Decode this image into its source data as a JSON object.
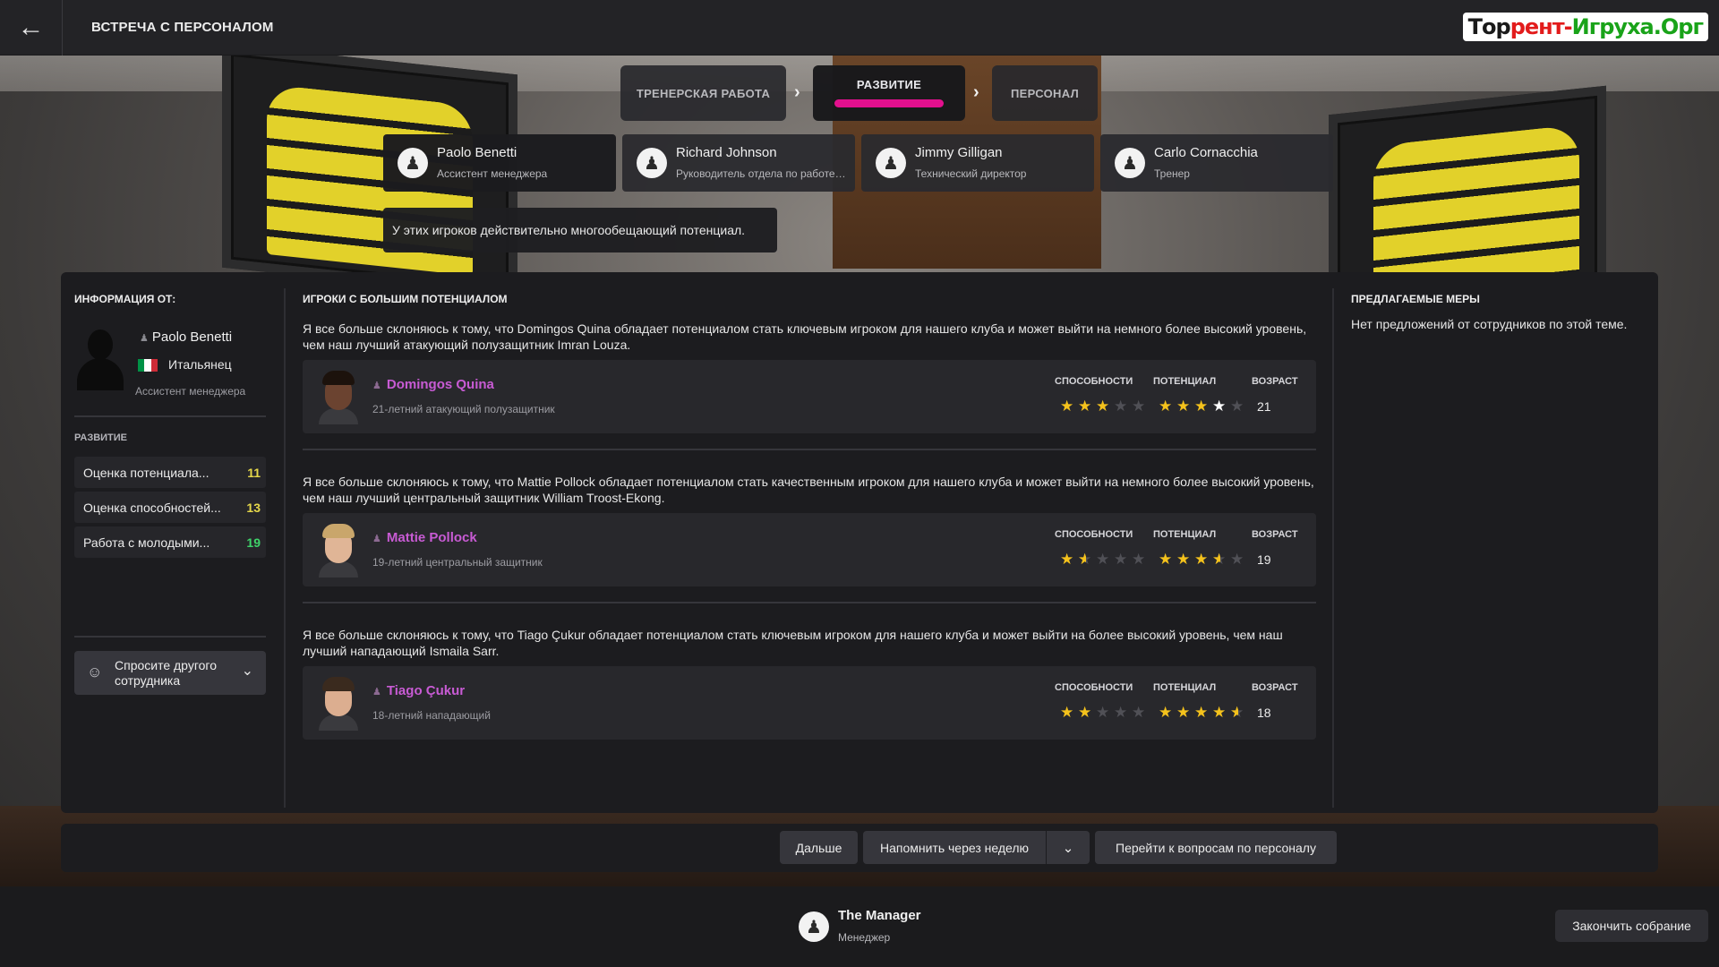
{
  "header": {
    "back_icon": "arrow-left-icon",
    "title": "ВСТРЕЧА С ПЕРСОНАЛОМ",
    "watermark": {
      "part1": "Тор",
      "part2": "рент-",
      "part3": "Игруха.Орг"
    }
  },
  "stages": {
    "tabs": [
      {
        "label": "ТРЕНЕРСКАЯ РАБОТА"
      },
      {
        "label": "РАЗВИТИЕ",
        "active": true
      },
      {
        "label": "ПЕРСОНАЛ"
      }
    ],
    "active_color": "#e3108e"
  },
  "staff": [
    {
      "name": "Paolo Benetti",
      "role": "Ассистент менеджера",
      "selected": true
    },
    {
      "name": "Richard Johnson",
      "role": "Руководитель отдела по работе с..."
    },
    {
      "name": "Jimmy Gilligan",
      "role": "Технический директор"
    },
    {
      "name": "Carlo Cornacchia",
      "role": "Тренер"
    }
  ],
  "tooltip": "У этих игроков действительно многообещающий потенциал.",
  "info": {
    "heading": "ИНФОРМАЦИЯ ОТ:",
    "name": "Paolo Benetti",
    "nationality": "Итальянец",
    "role": "Ассистент менеджера",
    "flag_colors": [
      "#009246",
      "#ffffff",
      "#ce2b37"
    ],
    "section": "РАЗВИТИЕ",
    "attributes": [
      {
        "label": "Оценка потенциала...",
        "value": "11",
        "color": "#e6d84a"
      },
      {
        "label": "Оценка способностей...",
        "value": "13",
        "color": "#e6d84a"
      },
      {
        "label": "Работа с молодыми...",
        "value": "19",
        "color": "#3fd36a"
      }
    ],
    "ask_other": "Спросите другого сотрудника"
  },
  "players_section": {
    "heading": "ИГРОКИ С БОЛЬШИМ ПОТЕНЦИАЛОМ",
    "col_ability": "СПОСОБНОСТИ",
    "col_potential": "ПОТЕНЦИАЛ",
    "col_age": "ВОЗРАСТ",
    "players": [
      {
        "text": "Я все больше склоняюсь к тому, что Domingos Quina обладает потенциалом стать ключевым игроком для нашего клуба и может выйти на немного более высокий уровень, чем наш лучший атакующий полузащитник Imran Louza.",
        "name": "Domingos Quina",
        "desc": "21-летний атакующий полузащитник",
        "ability_stars": 3,
        "potential_stars": 4,
        "age": "21",
        "skin": "#6b4330",
        "hair": "#1c120c"
      },
      {
        "text": "Я все больше склоняюсь к тому, что Mattie Pollock обладает потенциалом стать качественным игроком для нашего клуба и может выйти на немного более высокий уровень, чем наш лучший центральный защитник William Troost-Ekong.",
        "name": "Mattie Pollock",
        "desc": "19-летний центральный защитник",
        "ability_stars": 1.5,
        "potential_stars": 3.5,
        "age": "19",
        "skin": "#e0b596",
        "hair": "#c9a66b"
      },
      {
        "text": "Я все больше склоняюсь к тому, что Tiago Çukur обладает потенциалом стать ключевым игроком для нашего клуба и может выйти на более высокий уровень, чем наш лучший нападающий Ismaila Sarr.",
        "name": "Tiago Çukur",
        "desc": "18-летний нападающий",
        "ability_stars": 2,
        "potential_stars": 4.5,
        "age": "18",
        "skin": "#dcae90",
        "hair": "#3a2a1e"
      }
    ]
  },
  "suggestions": {
    "heading": "ПРЕДЛАГАЕМЫЕ МЕРЫ",
    "text": "Нет предложений от сотрудников по этой теме."
  },
  "actions": {
    "next": "Дальше",
    "remind": "Напомнить через неделю",
    "goto_staff": "Перейти к вопросам по персоналу"
  },
  "footer": {
    "manager_name": "The Manager",
    "manager_role": "Менеджер",
    "end_meeting": "Закончить собрание"
  }
}
